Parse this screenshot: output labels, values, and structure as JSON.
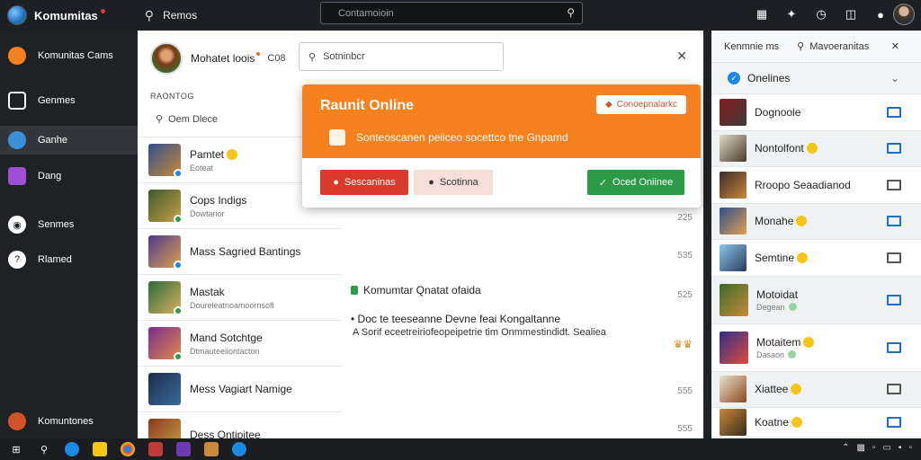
{
  "app": {
    "title": "Komumitas"
  },
  "titlebar": {
    "search_label": "Remos",
    "search_placeholder": "Contamoioin",
    "icons": [
      "qr-icon",
      "puzzle-icon",
      "clock-icon",
      "window-icon",
      "notification-icon"
    ]
  },
  "sidebar": {
    "items": [
      {
        "label": "Komunitas Cams",
        "icon": "community-avatar-icon",
        "color": "#f5811f"
      },
      {
        "label": "Genmes",
        "icon": "games-icon",
        "color": "#ffffff"
      },
      {
        "label": "Ganhe",
        "icon": "ganhe-icon",
        "color": "#3a8fd6"
      },
      {
        "label": "Dang",
        "icon": "dang-icon",
        "color": "#a04fd6"
      },
      {
        "label": "Senmes",
        "icon": "discord-icon",
        "color": "#ffffff"
      },
      {
        "label": "Rlamed",
        "icon": "help-icon",
        "color": "#ffffff"
      }
    ],
    "footer_label": "Komuntones"
  },
  "list_panel": {
    "title": "Mohatet loois",
    "count": "C08",
    "section_label": "RAONTOG",
    "search_label": "Oem Dlece",
    "contacts": [
      {
        "name": "Pamtet",
        "sub": "Eoteat"
      },
      {
        "name": "Cops Indigs",
        "sub": "Dowtarior"
      },
      {
        "name": "Mass Sagried Bantings",
        "sub": ""
      },
      {
        "name": "Mastak",
        "sub": "Doureleatnoamoornsofl"
      },
      {
        "name": "Mand Sotchtge",
        "sub": "Dtmauteeiiontacton"
      },
      {
        "name": "Mess Vagiart Namige",
        "sub": ""
      },
      {
        "name": "Dess Ontipitee",
        "sub": ""
      }
    ]
  },
  "chat": {
    "search_placeholder": "Sotninbcr",
    "numbers": [
      "225",
      "535",
      "525",
      "555",
      "555"
    ],
    "message_title": "Komumtar Qnatat ofaida",
    "message_line1": "• Doc te teeseanne Devne feai Kongaltanne",
    "message_line2": "A Sorif eceetreiriofeopeipetrie tim Onmmestindidt. Sealiea"
  },
  "popup": {
    "title": "Raunit Online",
    "top_button": "Conoepnalarkc",
    "body_text": "Sonteoscanen peiiceo socettco tne Gnpamd",
    "btn_red": "Sescaninas",
    "btn_gray": "Scotinna",
    "btn_green": "Oced Oniinee"
  },
  "right_panel": {
    "header_left": "Kenmnie ms",
    "header_search": "Mavoeranitas",
    "online_label": "Onelines",
    "friends": [
      {
        "name": "Dognoole",
        "sub": "",
        "emoji": false
      },
      {
        "name": "Nontolfont",
        "sub": "",
        "emoji": true
      },
      {
        "name": "Rroopo Seaadianod",
        "sub": "",
        "emoji": false
      },
      {
        "name": "Monahe",
        "sub": "",
        "emoji": true
      },
      {
        "name": "Semtine",
        "sub": "",
        "emoji": true
      },
      {
        "name": "Motoidat",
        "sub": "Degean",
        "emoji": false
      },
      {
        "name": "Motaitem",
        "sub": "Dasaon",
        "emoji": true
      },
      {
        "name": "Xiattee",
        "sub": "",
        "emoji": true
      },
      {
        "name": "Koatne",
        "sub": "",
        "emoji": true
      }
    ]
  },
  "taskbar": {
    "icons": [
      "windows-icon",
      "search-icon",
      "edge-icon",
      "folder-icon",
      "chrome-icon",
      "app-icon",
      "vs-icon",
      "game-icon",
      "blue-app-icon"
    ]
  }
}
